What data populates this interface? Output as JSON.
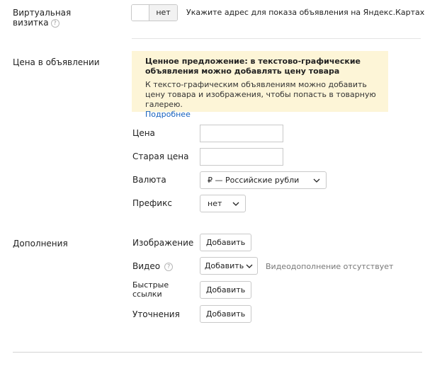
{
  "vcard": {
    "label_line1": "Виртуальная",
    "label_line2": "визитка",
    "hint_icon": "?",
    "toggle_value": "нет",
    "description": "Укажите адрес для показа объявления на Яндекс.Картах"
  },
  "price_section": {
    "label": "Цена в объявлении",
    "notice": {
      "title": "Ценное предложение: в текстово-графические объявления можно добавлять цену товара",
      "body": "К тексто-графическим объявлениям можно добавить цену товара и изображения, чтобы попасть в товарную галерею.",
      "link": "Подробнее",
      "bg_color": "#fdf5d7"
    },
    "price_label": "Цена",
    "price_value": "",
    "old_price_label": "Старая цена",
    "old_price_value": "",
    "currency_label": "Валюта",
    "currency_value": "₽ — Российские рубли",
    "prefix_label": "Префикс",
    "prefix_value": "нет"
  },
  "extras": {
    "label": "Дополнения",
    "image_label": "Изображение",
    "image_button": "Добавить",
    "video_label": "Видео",
    "video_hint_icon": "?",
    "video_button": "Добавить",
    "video_status": "Видеодополнение отсутствует",
    "quicklinks_label_line1": "Быстрые",
    "quicklinks_label_line2": "ссылки",
    "quicklinks_button": "Добавить",
    "callouts_label": "Уточнения",
    "callouts_button": "Добавить"
  },
  "colors": {
    "link": "#1560bd",
    "border": "#c9c9c9"
  }
}
